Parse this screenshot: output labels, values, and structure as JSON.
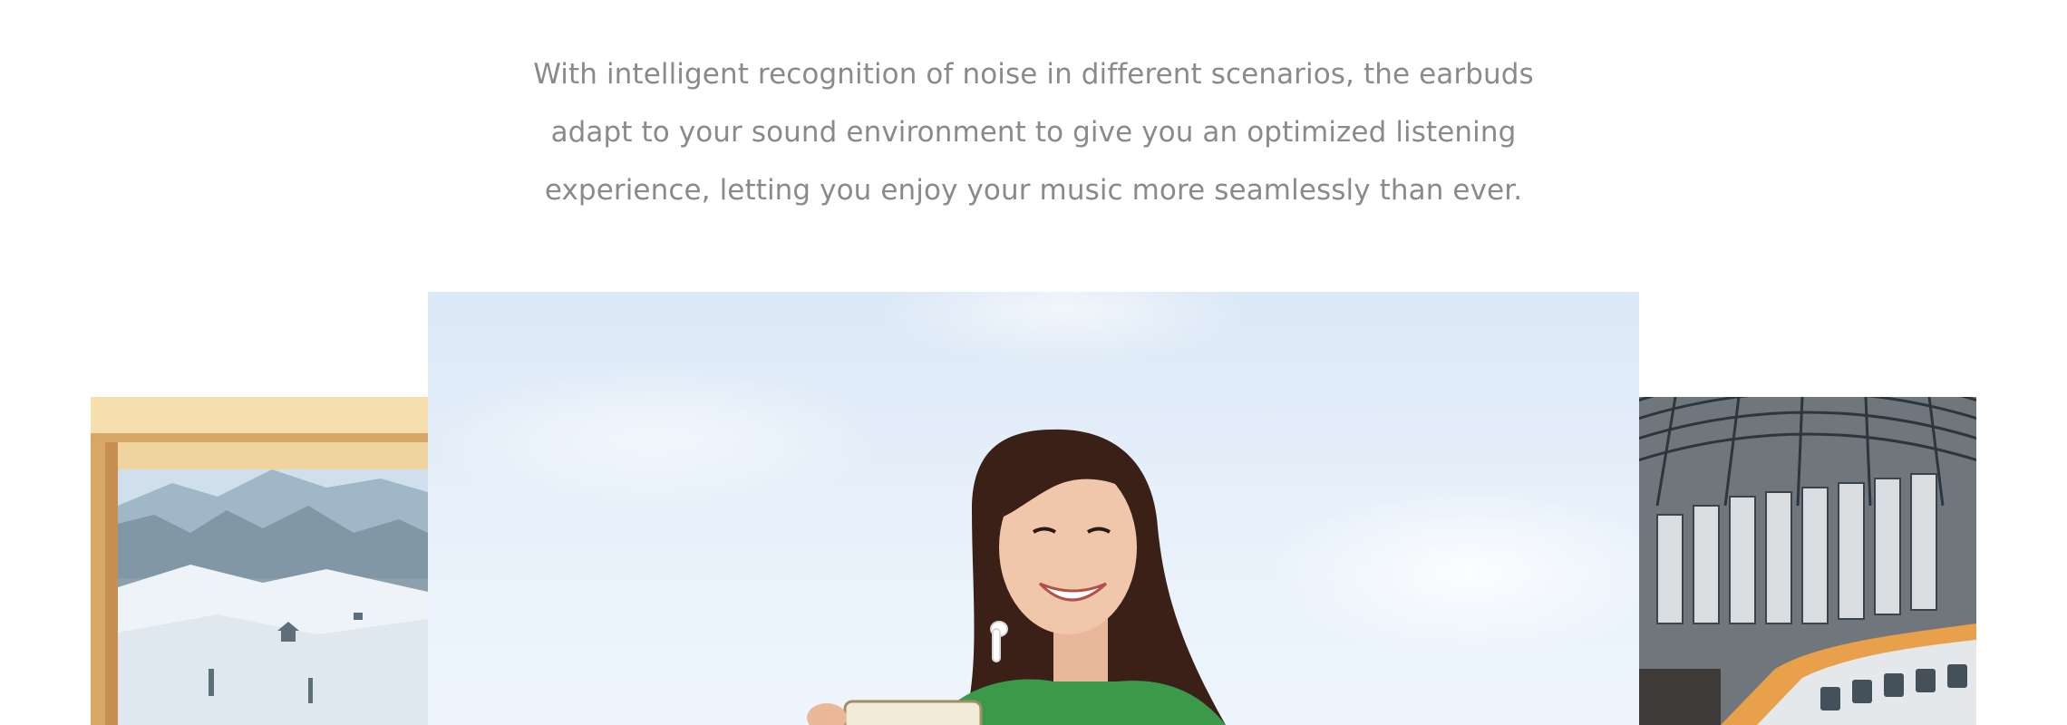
{
  "intro": {
    "line_1": "With intelligent recognition of noise in different scenarios, the earbuds",
    "line_2": "adapt to your sound environment to give you an optimized listening",
    "line_3": "experience, letting you enjoy your music more seamlessly than ever."
  },
  "scenes": [
    {
      "name": "window-mountain-view",
      "colors": {
        "frame": "#d9a663",
        "sky": "#d7e6f2",
        "snow": "#f2f5f8"
      }
    },
    {
      "name": "woman-smiling-with-earbuds",
      "colors": {
        "sky": "#e1edf9",
        "hair": "#3a2016",
        "shirt": "#3b9a4a"
      }
    },
    {
      "name": "train-station",
      "colors": {
        "roof": "#3d464e",
        "train": "#e6e8ea",
        "stripe": "#e8a24a"
      }
    }
  ]
}
